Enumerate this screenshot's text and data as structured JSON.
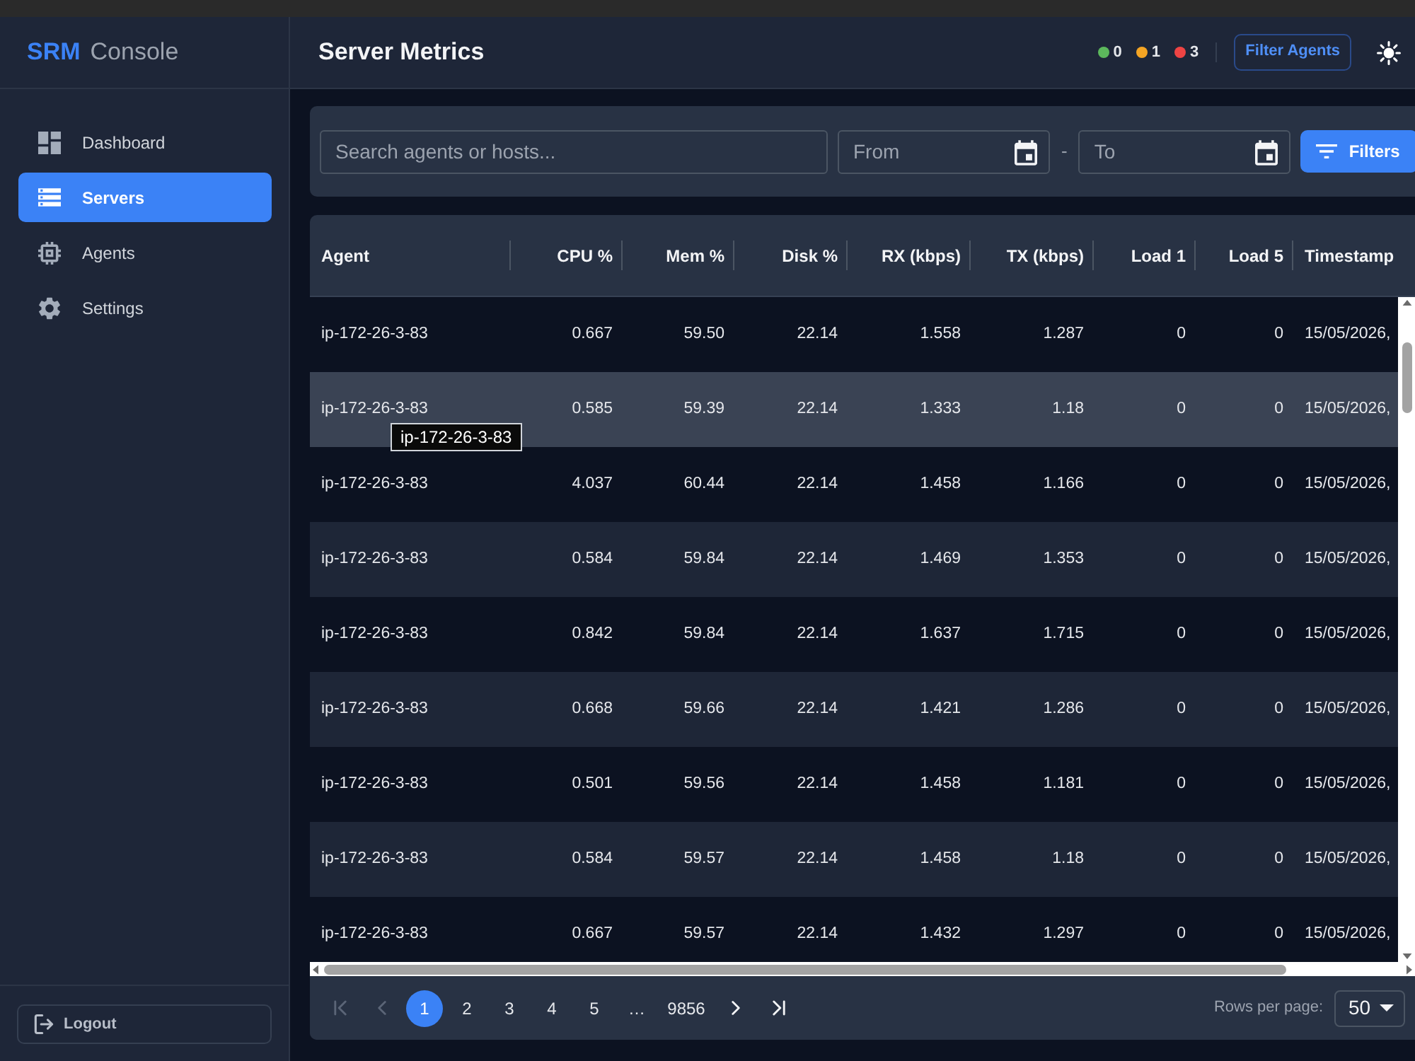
{
  "sidebar": {
    "brand": {
      "accent": "SRM",
      "text": "Console"
    },
    "items": [
      {
        "kind": "dashboard",
        "label": "Dashboard",
        "selected": false
      },
      {
        "kind": "servers",
        "label": "Servers",
        "selected": true
      },
      {
        "kind": "agents",
        "label": "Agents",
        "selected": false
      },
      {
        "kind": "settings",
        "label": "Settings",
        "selected": false
      }
    ],
    "logout": "Logout"
  },
  "header": {
    "title": "Server Metrics",
    "status_counts": [
      {
        "color": "#5cb85c",
        "count": "0"
      },
      {
        "color": "#f5a524",
        "count": "1"
      },
      {
        "color": "#ef4444",
        "count": "3"
      }
    ],
    "filter_button": "Filter Agents"
  },
  "filters": {
    "search": {
      "placeholder": "Search agents or hosts..."
    },
    "from": {
      "placeholder": "From"
    },
    "separator": "-",
    "to": {
      "placeholder": "To"
    },
    "button": "Filters"
  },
  "table": {
    "columns": [
      {
        "label": "Agent",
        "kind": "host"
      },
      {
        "label": "CPU %",
        "kind": "number"
      },
      {
        "label": "Mem %",
        "kind": "number"
      },
      {
        "label": "Disk %",
        "kind": "number"
      },
      {
        "label": "RX (kbps)",
        "kind": "number"
      },
      {
        "label": "TX (kbps)",
        "kind": "number"
      },
      {
        "label": "Load 1",
        "kind": "number"
      },
      {
        "label": "Load 5",
        "kind": "number"
      },
      {
        "label": "Timestamp",
        "kind": "time"
      }
    ],
    "rows": [
      {
        "hovered": false,
        "cells": [
          "ip-172-26-3-83",
          "0.667",
          "59.50",
          "22.14",
          "1.558",
          "1.287",
          "0",
          "0",
          "15/05/2026,"
        ]
      },
      {
        "hovered": true,
        "tooltip": "ip-172-26-3-83",
        "cells": [
          "ip-172-26-3-83",
          "0.585",
          "59.39",
          "22.14",
          "1.333",
          "1.18",
          "0",
          "0",
          "15/05/2026,"
        ]
      },
      {
        "hovered": false,
        "cells": [
          "ip-172-26-3-83",
          "4.037",
          "60.44",
          "22.14",
          "1.458",
          "1.166",
          "0",
          "0",
          "15/05/2026,"
        ]
      },
      {
        "hovered": false,
        "cells": [
          "ip-172-26-3-83",
          "0.584",
          "59.84",
          "22.14",
          "1.469",
          "1.353",
          "0",
          "0",
          "15/05/2026,"
        ]
      },
      {
        "hovered": false,
        "cells": [
          "ip-172-26-3-83",
          "0.842",
          "59.84",
          "22.14",
          "1.637",
          "1.715",
          "0",
          "0",
          "15/05/2026,"
        ]
      },
      {
        "hovered": false,
        "cells": [
          "ip-172-26-3-83",
          "0.668",
          "59.66",
          "22.14",
          "1.421",
          "1.286",
          "0",
          "0",
          "15/05/2026,"
        ]
      },
      {
        "hovered": false,
        "cells": [
          "ip-172-26-3-83",
          "0.501",
          "59.56",
          "22.14",
          "1.458",
          "1.181",
          "0",
          "0",
          "15/05/2026,"
        ]
      },
      {
        "hovered": false,
        "cells": [
          "ip-172-26-3-83",
          "0.584",
          "59.57",
          "22.14",
          "1.458",
          "1.18",
          "0",
          "0",
          "15/05/2026,"
        ]
      },
      {
        "hovered": false,
        "cells": [
          "ip-172-26-3-83",
          "0.667",
          "59.57",
          "22.14",
          "1.432",
          "1.297",
          "0",
          "0",
          "15/05/2026,"
        ]
      }
    ]
  },
  "pagination": {
    "first": {
      "disabled": true
    },
    "prev": {
      "disabled": true
    },
    "pages": [
      {
        "kind": "page",
        "label": "1",
        "selected": true
      },
      {
        "kind": "page",
        "label": "2",
        "selected": false
      },
      {
        "kind": "page",
        "label": "3",
        "selected": false
      },
      {
        "kind": "page",
        "label": "4",
        "selected": false
      },
      {
        "kind": "page",
        "label": "5",
        "selected": false
      },
      {
        "kind": "ellipsis",
        "label": "…",
        "selected": false
      },
      {
        "kind": "page",
        "label": "9856",
        "selected": false
      }
    ],
    "next": {
      "disabled": false
    },
    "last": {
      "disabled": false
    },
    "rows_per_page": {
      "label": "Rows per page:",
      "value": "50"
    }
  }
}
